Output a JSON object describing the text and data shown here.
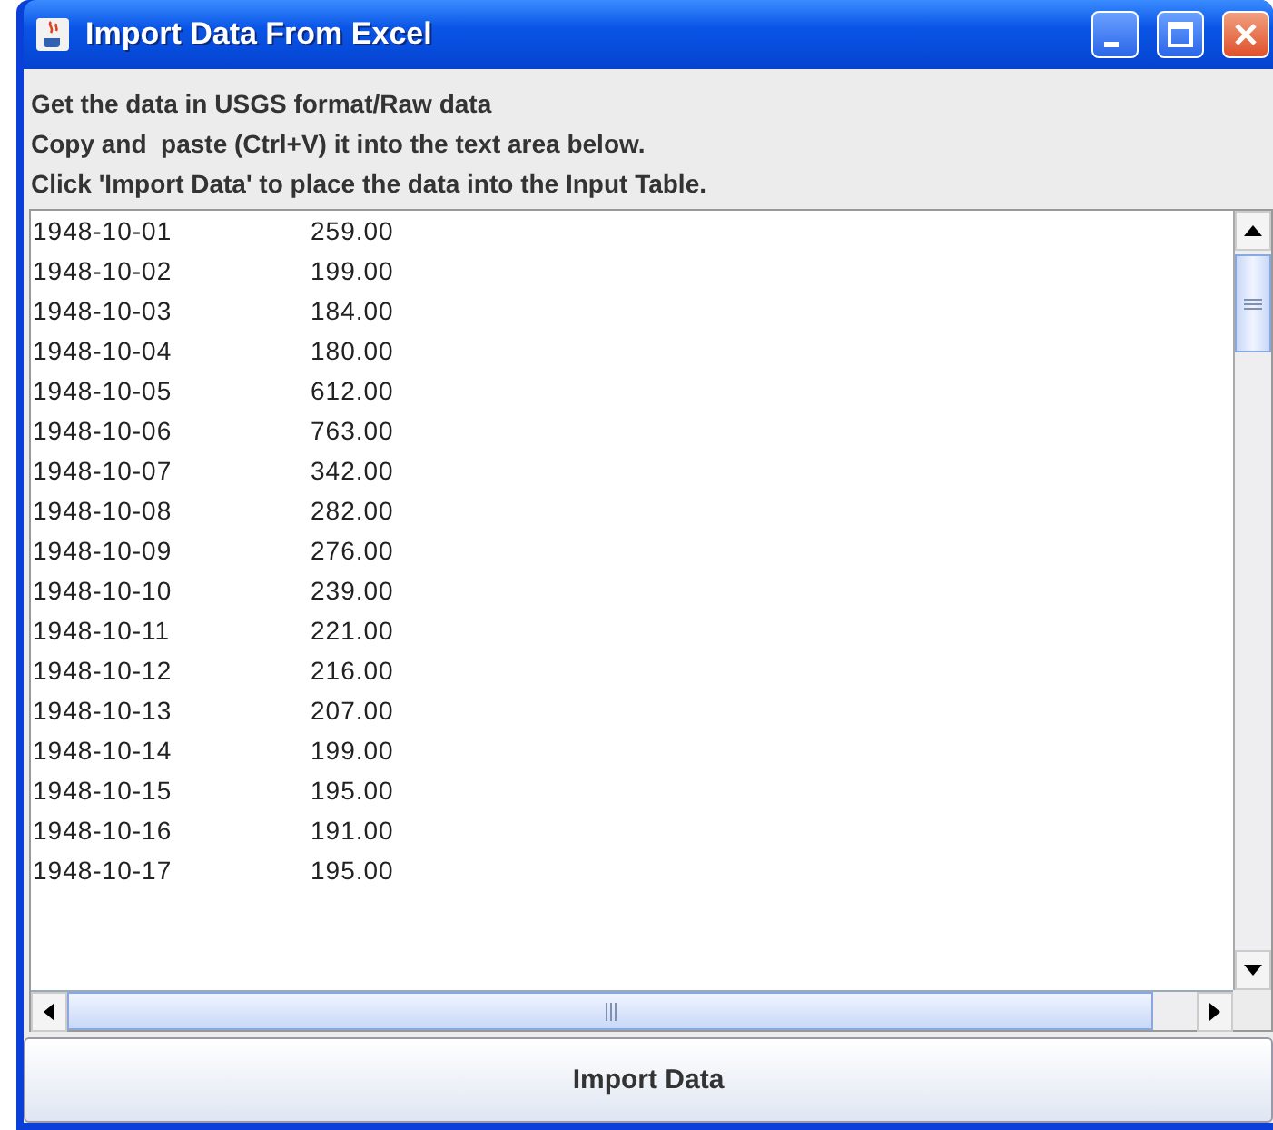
{
  "window": {
    "title": "Import Data From Excel"
  },
  "instructions": [
    "Get the data in USGS format/Raw data",
    "Copy and  paste (Ctrl+V) it into the text area below.",
    "Click 'Import Data' to place the data into the Input Table."
  ],
  "text_area": {
    "rows": [
      {
        "date": "1948-10-01",
        "value": "259.00"
      },
      {
        "date": "1948-10-02",
        "value": "199.00"
      },
      {
        "date": "1948-10-03",
        "value": "184.00"
      },
      {
        "date": "1948-10-04",
        "value": "180.00"
      },
      {
        "date": "1948-10-05",
        "value": "612.00"
      },
      {
        "date": "1948-10-06",
        "value": "763.00"
      },
      {
        "date": "1948-10-07",
        "value": "342.00"
      },
      {
        "date": "1948-10-08",
        "value": "282.00"
      },
      {
        "date": "1948-10-09",
        "value": "276.00"
      },
      {
        "date": "1948-10-10",
        "value": "239.00"
      },
      {
        "date": "1948-10-11",
        "value": "221.00"
      },
      {
        "date": "1948-10-12",
        "value": "216.00"
      },
      {
        "date": "1948-10-13",
        "value": "207.00"
      },
      {
        "date": "1948-10-14",
        "value": "199.00"
      },
      {
        "date": "1948-10-15",
        "value": "195.00"
      },
      {
        "date": "1948-10-16",
        "value": "191.00"
      },
      {
        "date": "1948-10-17",
        "value": "195.00"
      }
    ]
  },
  "buttons": [
    "Import Data"
  ]
}
